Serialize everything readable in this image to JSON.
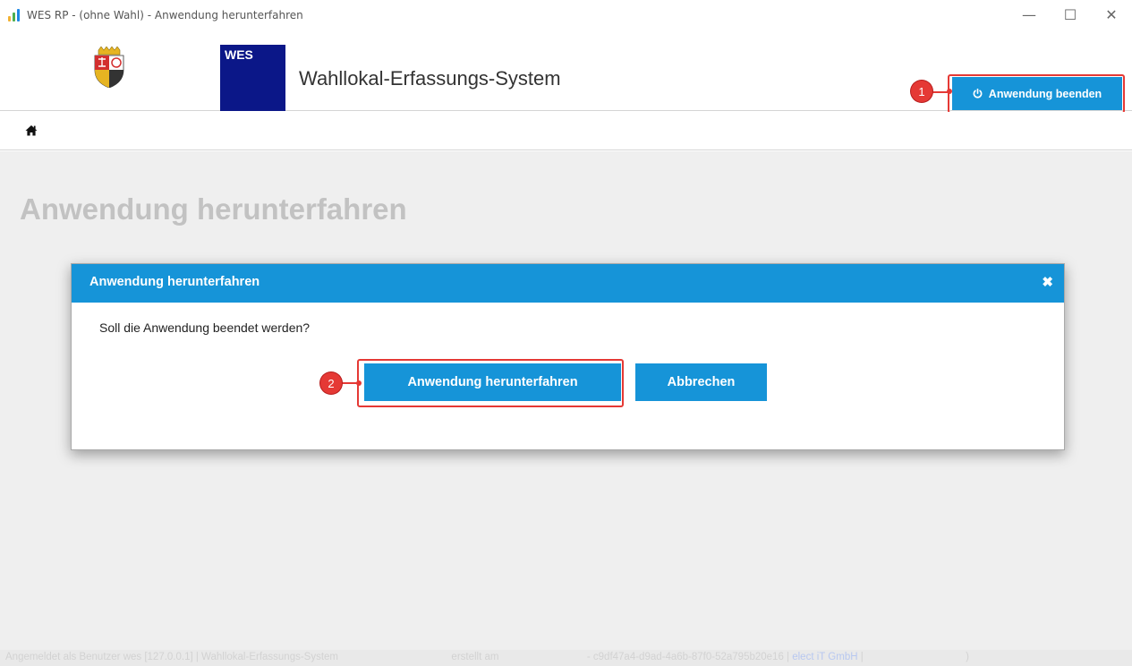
{
  "window": {
    "title": "WES RP - (ohne Wahl) - Anwendung herunterfahren",
    "minimize_glyph": "—",
    "maximize_glyph": "☐",
    "close_glyph": "✕"
  },
  "header": {
    "wes_badge": "WES",
    "app_title": "Wahllokal-Erfassungs-System",
    "exit_button_label": "Anwendung beenden",
    "exit_icon": "power-icon",
    "coat_of_arms": "rhineland-palatinate-coat-of-arms"
  },
  "nav": {
    "home_icon": "home-icon"
  },
  "page": {
    "title": "Anwendung herunterfahren"
  },
  "dialog": {
    "title": "Anwendung herunterfahren",
    "close_glyph": "✖",
    "message": "Soll die Anwendung beendet werden?",
    "confirm_label": "Anwendung herunterfahren",
    "cancel_label": "Abbrechen"
  },
  "annotations": {
    "marker_1": "1",
    "marker_2": "2"
  },
  "footer": {
    "left": "Angemeldet als Benutzer wes [127.0.0.1] | Wahllokal-Erfassungs-System",
    "middle": "erstellt am",
    "id": "- c9df47a4-d9ad-4a6b-87f0-52a795b20e16 |",
    "company": "elect iT GmbH",
    "sep": "|",
    "tail": ")"
  },
  "colors": {
    "accent": "#1694d8",
    "wes_badge": "#0b1788",
    "highlight": "#e53935",
    "content_bg": "#efefef"
  }
}
